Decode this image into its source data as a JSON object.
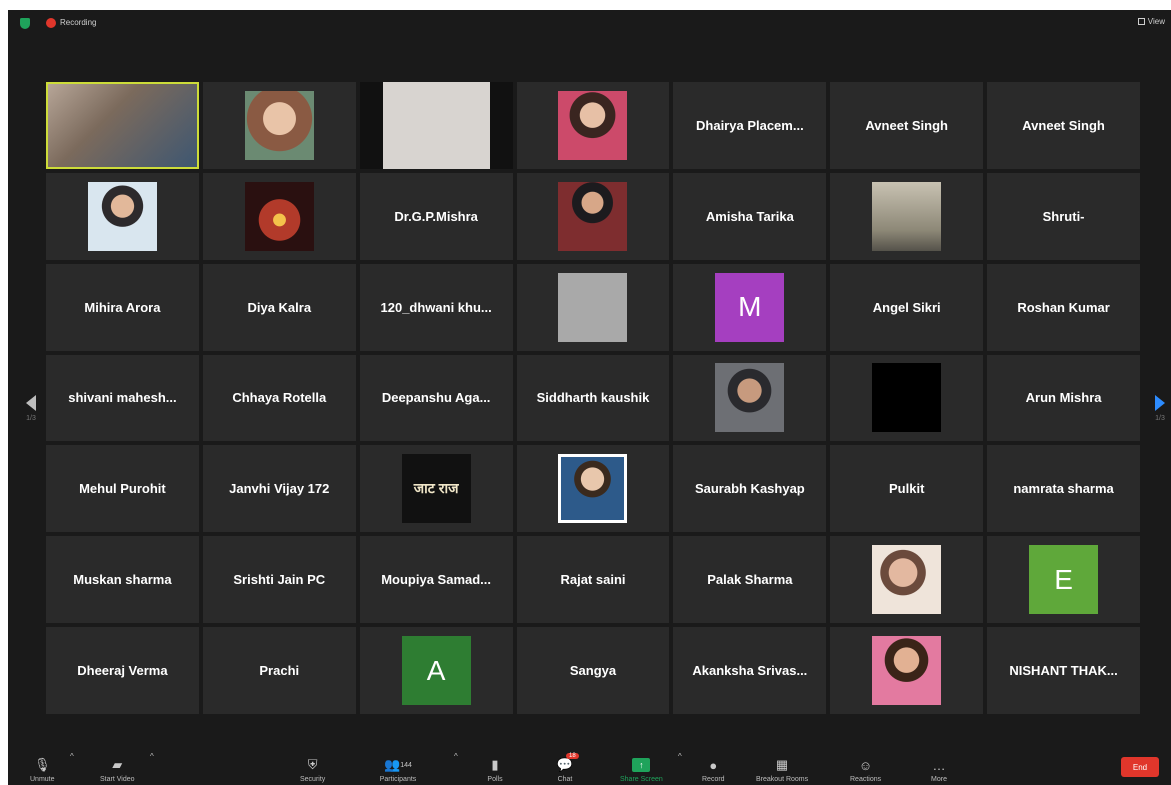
{
  "topbar": {
    "recording_label": "Recording",
    "view_label": "View"
  },
  "navigation": {
    "prev_page": "1/3",
    "next_page": "1/3"
  },
  "tiles": [
    {
      "kind": "photo",
      "name": "",
      "cls": "p1 wide",
      "active": true
    },
    {
      "kind": "photo",
      "name": "",
      "cls": "p2"
    },
    {
      "kind": "photo",
      "name": "",
      "cls": "p3 wide"
    },
    {
      "kind": "photo",
      "name": "",
      "cls": "p4"
    },
    {
      "kind": "name",
      "name": "Dhairya  Placem..."
    },
    {
      "kind": "name",
      "name": "Avneet Singh"
    },
    {
      "kind": "name",
      "name": "Avneet Singh"
    },
    {
      "kind": "photo",
      "name": "",
      "cls": "p5"
    },
    {
      "kind": "photo",
      "name": "",
      "cls": "p6"
    },
    {
      "kind": "name",
      "name": "Dr.G.P.Mishra"
    },
    {
      "kind": "photo",
      "name": "",
      "cls": "p7"
    },
    {
      "kind": "name",
      "name": "Amisha Tarika"
    },
    {
      "kind": "photo",
      "name": "",
      "cls": "p8"
    },
    {
      "kind": "name",
      "name": "Shruti-"
    },
    {
      "kind": "name",
      "name": "Mihira Arora"
    },
    {
      "kind": "name",
      "name": "Diya Kalra"
    },
    {
      "kind": "name",
      "name": "120_dhwani  khu..."
    },
    {
      "kind": "photo",
      "name": "",
      "cls": "p9"
    },
    {
      "kind": "letter",
      "letter": "M",
      "color": "#a53fc0"
    },
    {
      "kind": "name",
      "name": "Angel Sikri"
    },
    {
      "kind": "name",
      "name": "Roshan Kumar"
    },
    {
      "kind": "name",
      "name": "shivani  mahesh..."
    },
    {
      "kind": "name",
      "name": "Chhaya Rotella"
    },
    {
      "kind": "name",
      "name": "Deepanshu  Aga..."
    },
    {
      "kind": "name",
      "name": "Siddharth kaushik"
    },
    {
      "kind": "photo",
      "name": "",
      "cls": "p10"
    },
    {
      "kind": "photo",
      "name": "",
      "cls": "p11"
    },
    {
      "kind": "name",
      "name": "Arun Mishra"
    },
    {
      "kind": "name",
      "name": "Mehul Purohit"
    },
    {
      "kind": "name",
      "name": "Janvhi Vijay 172"
    },
    {
      "kind": "logo",
      "name": "",
      "cls": "p12",
      "logo_text": "जाट राज"
    },
    {
      "kind": "photo",
      "name": "",
      "cls": "p13"
    },
    {
      "kind": "name",
      "name": "Saurabh Kashyap"
    },
    {
      "kind": "name",
      "name": "Pulkit"
    },
    {
      "kind": "name",
      "name": "namrata sharma"
    },
    {
      "kind": "name",
      "name": "Muskan sharma"
    },
    {
      "kind": "name",
      "name": "Srishti Jain PC"
    },
    {
      "kind": "name",
      "name": "Moupiya  Samad..."
    },
    {
      "kind": "name",
      "name": "Rajat saini"
    },
    {
      "kind": "name",
      "name": "Palak Sharma"
    },
    {
      "kind": "photo",
      "name": "",
      "cls": "p14"
    },
    {
      "kind": "letter",
      "letter": "E",
      "color": "#5fa83a"
    },
    {
      "kind": "name",
      "name": "Dheeraj Verma"
    },
    {
      "kind": "name",
      "name": "Prachi"
    },
    {
      "kind": "letter",
      "letter": "A",
      "color": "#2e7d32"
    },
    {
      "kind": "name",
      "name": "Sangya"
    },
    {
      "kind": "name",
      "name": "Akanksha  Srivas..."
    },
    {
      "kind": "photo",
      "name": "",
      "cls": "p15"
    },
    {
      "kind": "name",
      "name": "NISHANT  THAK..."
    }
  ],
  "toolbar": {
    "unmute": "Unmute",
    "start_video": "Start Video",
    "security": "Security",
    "participants": "Participants",
    "participants_count": "144",
    "polls": "Polls",
    "chat": "Chat",
    "chat_badge": "18",
    "share_screen": "Share Screen",
    "record": "Record",
    "breakout": "Breakout Rooms",
    "reactions": "Reactions",
    "more": "More",
    "end": "End"
  }
}
